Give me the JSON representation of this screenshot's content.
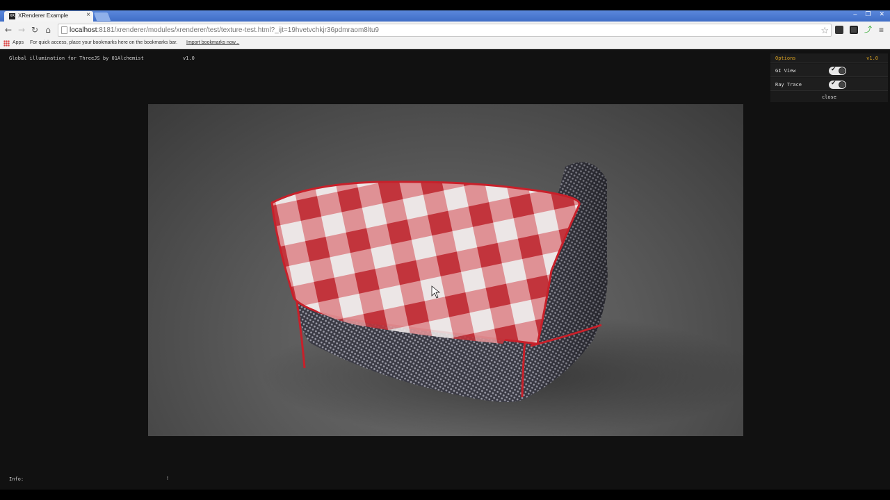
{
  "browser": {
    "tab_title": "XRenderer Example",
    "tab_close": "×",
    "favicon_text": "XR",
    "url_host": "localhost",
    "url_rest": ":8181/xrenderer/modules/xrenderer/test/texture-test.html?_ijt=19hvetvchkjr36pdmraom8ltu9",
    "bookmarks": {
      "apps_label": "Apps",
      "hint": "For quick access, place your bookmarks here on the bookmarks bar.",
      "import_link": "Import bookmarks now..."
    }
  },
  "app": {
    "title": "Global illumination for ThreeJS by 01Alchemist",
    "version": "v1.0",
    "info_label": "Info:",
    "info_mark": "!"
  },
  "options_panel": {
    "title": "Options",
    "version": "v1.0",
    "rows": [
      {
        "label": "GI View",
        "enabled": true
      },
      {
        "label": "Ray Trace",
        "enabled": true
      }
    ],
    "close_label": "close"
  },
  "colors": {
    "accent": "#d8a020",
    "fabric_red": "#c8202a",
    "fabric_white": "#e8e2e2",
    "mesh_dark": "#2e2e36"
  }
}
